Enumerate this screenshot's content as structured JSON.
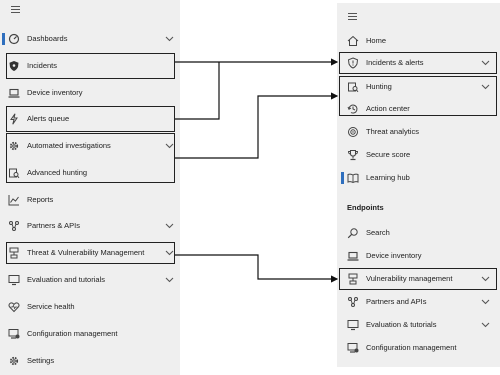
{
  "left_nav": {
    "items": [
      {
        "label": "Dashboards",
        "icon": "dashboard-icon",
        "expandable": true,
        "active": true
      },
      {
        "label": "Incidents",
        "icon": "shield-icon",
        "expandable": false,
        "highlighted": true
      },
      {
        "label": "Device inventory",
        "icon": "laptop-icon",
        "expandable": false
      },
      {
        "label": "Alerts queue",
        "icon": "lightning-icon",
        "expandable": false,
        "highlighted": true
      },
      {
        "label": "Automated investigations",
        "icon": "gear-icon",
        "expandable": true,
        "highlighted": true
      },
      {
        "label": "Advanced hunting",
        "icon": "hunting-icon",
        "expandable": false,
        "highlighted": true
      },
      {
        "label": "Reports",
        "icon": "chart-icon",
        "expandable": false
      },
      {
        "label": "Partners & APIs",
        "icon": "partners-icon",
        "expandable": true
      },
      {
        "label": "Threat & Vulnerability Management",
        "icon": "vulnerability-icon",
        "expandable": true,
        "highlighted": true
      },
      {
        "label": "Evaluation and tutorials",
        "icon": "evaluation-icon",
        "expandable": true
      },
      {
        "label": "Service health",
        "icon": "heart-icon",
        "expandable": false
      },
      {
        "label": "Configuration management",
        "icon": "config-icon",
        "expandable": false
      },
      {
        "label": "Settings",
        "icon": "gear-icon",
        "expandable": false
      }
    ]
  },
  "right_nav": {
    "items": [
      {
        "label": "Home",
        "icon": "home-icon",
        "expandable": false
      },
      {
        "label": "Incidents & alerts",
        "icon": "shield-alert-icon",
        "expandable": true,
        "highlighted": true
      },
      {
        "label": "Hunting",
        "icon": "hunting-icon",
        "expandable": true,
        "highlighted": true
      },
      {
        "label": "Action center",
        "icon": "action-center-icon",
        "expandable": false,
        "highlighted": true
      },
      {
        "label": "Threat analytics",
        "icon": "threat-analytics-icon",
        "expandable": false
      },
      {
        "label": "Secure score",
        "icon": "trophy-icon",
        "expandable": false
      },
      {
        "label": "Learning hub",
        "icon": "book-icon",
        "expandable": false,
        "active": true
      }
    ],
    "section_heading": "Endpoints",
    "endpoint_items": [
      {
        "label": "Search",
        "icon": "search-icon",
        "expandable": false
      },
      {
        "label": "Device inventory",
        "icon": "laptop-icon",
        "expandable": false
      },
      {
        "label": "Vulnerability management",
        "icon": "vulnerability-icon",
        "expandable": true,
        "highlighted": true
      },
      {
        "label": "Partners and APIs",
        "icon": "partners-icon",
        "expandable": true
      },
      {
        "label": "Evaluation & tutorials",
        "icon": "evaluation-icon",
        "expandable": true
      },
      {
        "label": "Configuration management",
        "icon": "config-icon",
        "expandable": false
      }
    ]
  },
  "colors": {
    "pane_background": "#efefef",
    "accent": "#2f6fbe",
    "connector": "#111111"
  }
}
